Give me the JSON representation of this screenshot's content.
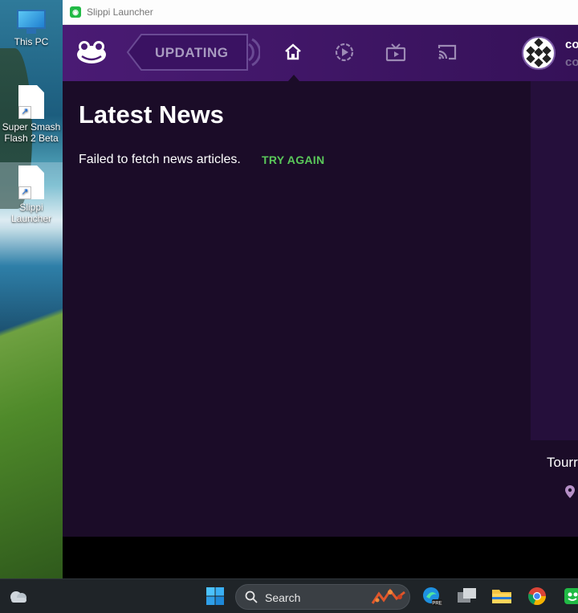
{
  "desktop": {
    "icons": [
      {
        "label": "This PC"
      },
      {
        "label": "Super Smash Flash 2 Beta"
      },
      {
        "label": "Slippi Launcher"
      }
    ]
  },
  "window": {
    "title": "Slippi Launcher"
  },
  "navbar": {
    "update_label": "UPDATING",
    "tabs": [
      "home-icon",
      "replays-icon",
      "spectate-icon",
      "broadcast-icon"
    ],
    "user_name": "co",
    "user_code": "co"
  },
  "news": {
    "title": "Latest News",
    "error_text": "Failed to fetch news articles.",
    "retry_label": "TRY AGAIN"
  },
  "sidebar": {
    "tournament_text": "Tourr"
  },
  "taskbar": {
    "search_label": "Search"
  },
  "colors": {
    "nav_start": "#4a1b74",
    "nav_end": "#351158",
    "content_bg": "#1b0c28",
    "accent_green": "#5ac85a",
    "updating_text": "#a89bc0"
  }
}
